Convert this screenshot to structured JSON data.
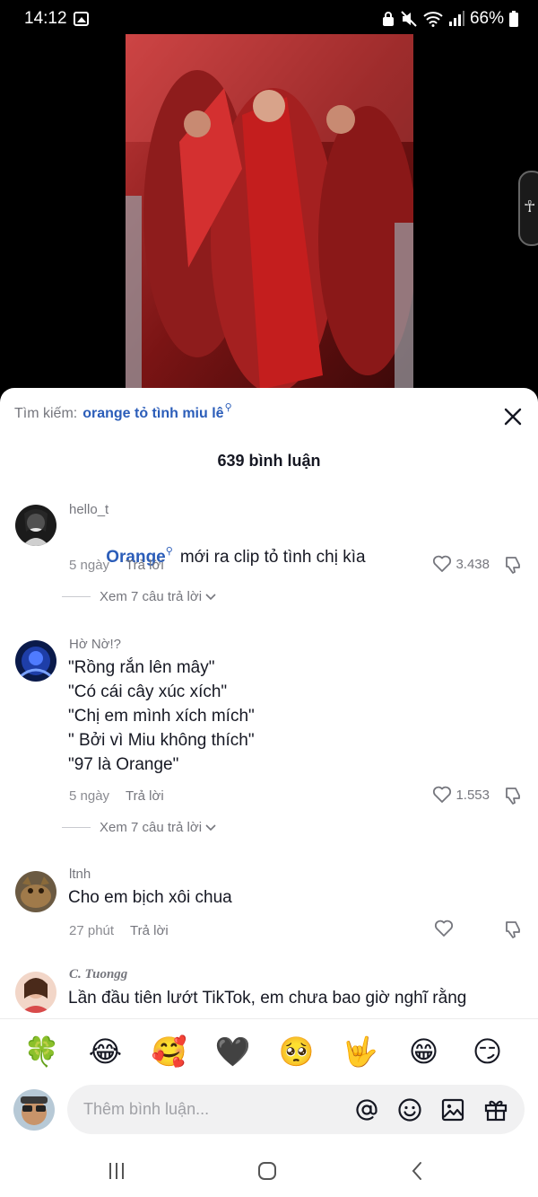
{
  "status_bar": {
    "time": "14:12",
    "battery": "66%",
    "icons": [
      "gallery-icon",
      "vpn-icon",
      "mute-icon",
      "wifi-icon",
      "signal-icon",
      "battery-icon"
    ]
  },
  "search": {
    "label": "Tìm kiếm:",
    "query": "orange tỏ tình miu lê"
  },
  "comments_header": {
    "count": "639 bình luận"
  },
  "comments": [
    {
      "username": "hello_t",
      "mention": "Orange",
      "text": "mới ra clip tỏ tình chị kìa",
      "time": "5 ngày",
      "reply_label": "Trả lời",
      "likes": "3.438",
      "view_replies": "Xem 7 câu trả lời"
    },
    {
      "username": "Hờ Nờ!?",
      "text": "\"Rồng rắn lên mây\"\n\"Có cái cây xúc xích\"\n\"Chị em mình xích mích\"\n\" Bởi vì Miu không thích\"\n\"97 là Orange\"",
      "time": "5 ngày",
      "reply_label": "Trả lời",
      "likes": "1.553",
      "view_replies": "Xem 7 câu trả lời"
    },
    {
      "username": "ltnh",
      "text": "Cho em bịch xôi chua",
      "time": "27 phút",
      "reply_label": "Trả lời",
      "likes": ""
    },
    {
      "username": "C. Tuongg",
      "text": "Lần đầu tiên lướt TikTok, em chưa bao giờ nghĩ rằng"
    }
  ],
  "emoji_bar": [
    "🍀",
    "😂",
    "🥰",
    "🖤",
    "🥺",
    "🤟",
    "😁",
    "😏"
  ],
  "input": {
    "placeholder": "Thêm bình luận...",
    "icons": [
      "mention-icon",
      "emoji-icon",
      "image-icon",
      "gift-icon"
    ]
  },
  "colors": {
    "accent": "#2b5db9",
    "muted": "#75767d",
    "text": "#161823"
  }
}
